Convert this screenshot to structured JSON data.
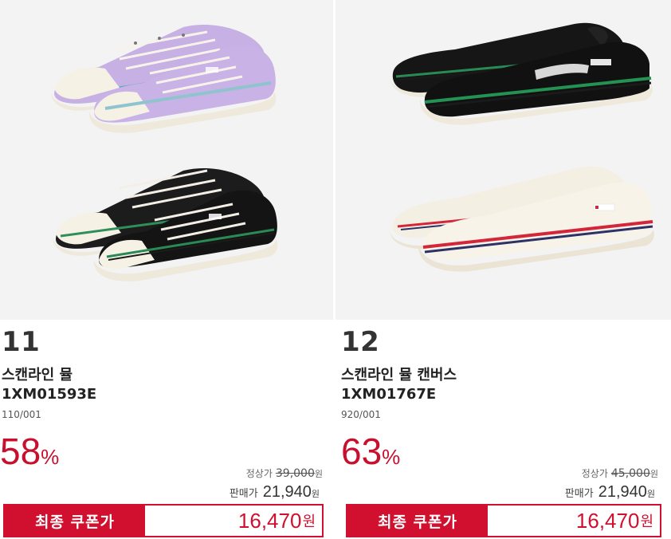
{
  "products": [
    {
      "rank": "11",
      "name": "스캔라인 뮬",
      "code": "1XM01593E",
      "color_code": "110/001",
      "discount": "58",
      "discount_unit": "%",
      "regular_label": "정상가",
      "regular_price": "39,000",
      "regular_unit": "원",
      "sale_label": "판매가",
      "sale_price": "21,940",
      "sale_unit": "원",
      "coupon_label": "최종 쿠폰가",
      "coupon_price": "16,470",
      "coupon_unit": "원",
      "brand_logo": "FILA"
    },
    {
      "rank": "12",
      "name": "스캔라인 뮬 캔버스",
      "code": "1XM01767E",
      "color_code": "920/001",
      "discount": "63",
      "discount_unit": "%",
      "regular_label": "정상가",
      "regular_price": "45,000",
      "regular_unit": "원",
      "sale_label": "판매가",
      "sale_price": "21,940",
      "sale_unit": "원",
      "coupon_label": "최종 쿠폰가",
      "coupon_price": "16,470",
      "coupon_unit": "원",
      "brand_logo": "FILA"
    }
  ],
  "colors": {
    "accent_red": "#d0102e",
    "image_bg": "#f3f3f3",
    "lilac": "#c9b3e6",
    "black": "#1a1a1a",
    "cream": "#f4efe2"
  }
}
